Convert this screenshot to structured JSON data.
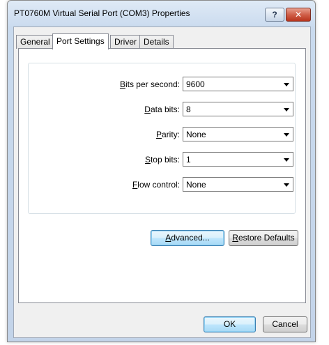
{
  "window": {
    "title": "PT0760M Virtual Serial Port (COM3) Properties",
    "help_label": "?",
    "close_label": "✕"
  },
  "tabs": [
    {
      "label": "General"
    },
    {
      "label": "Port Settings",
      "active": true
    },
    {
      "label": "Driver"
    },
    {
      "label": "Details"
    }
  ],
  "port_settings": {
    "bits_per_second": {
      "label_access": "B",
      "label_rest": "its per second:",
      "value": "9600"
    },
    "data_bits": {
      "label_access": "D",
      "label_rest": "ata bits:",
      "value": "8"
    },
    "parity": {
      "label_access": "P",
      "label_rest": "arity:",
      "value": "None"
    },
    "stop_bits": {
      "label_access": "S",
      "label_rest": "top bits:",
      "value": "1"
    },
    "flow_control": {
      "label_access": "F",
      "label_rest": "low control:",
      "value": "None"
    }
  },
  "buttons": {
    "advanced_access": "A",
    "advanced_rest": "dvanced...",
    "restore_access": "R",
    "restore_rest": "estore Defaults",
    "ok": "OK",
    "cancel": "Cancel"
  }
}
